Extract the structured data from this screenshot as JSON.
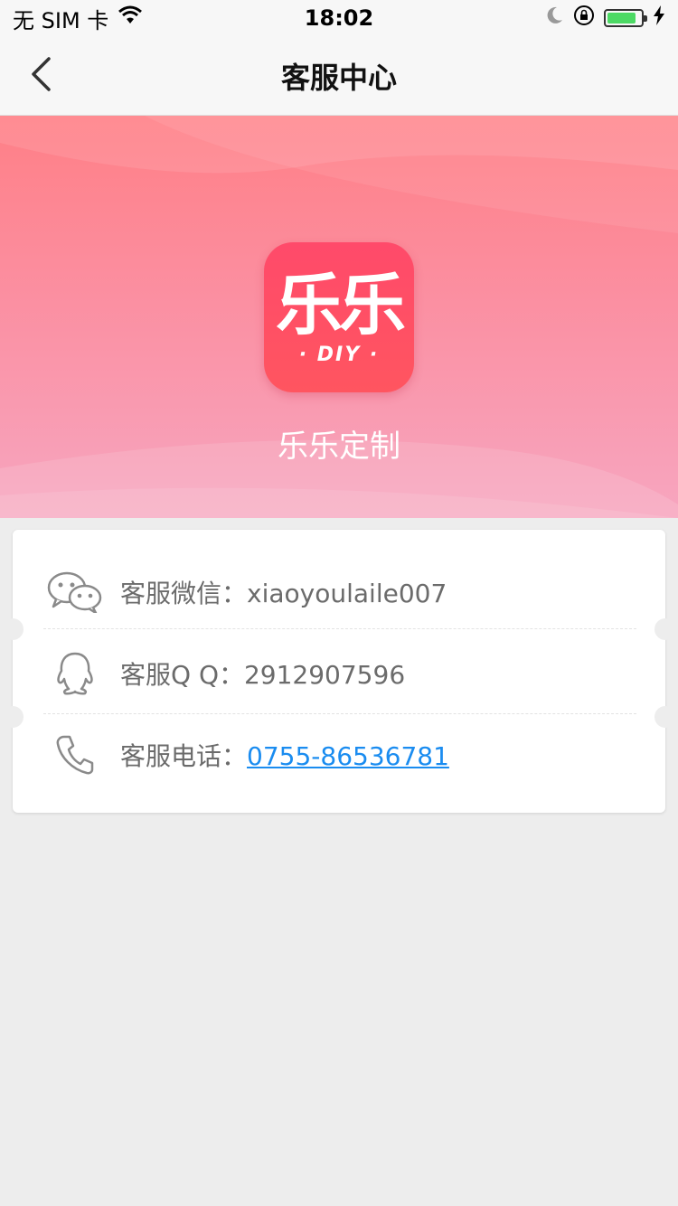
{
  "status_bar": {
    "carrier": "无 SIM 卡",
    "time": "18:02",
    "battery_level": 0.85,
    "battery_color": "#4cd964"
  },
  "nav": {
    "title": "客服中心",
    "back_icon": "chevron-left-icon"
  },
  "hero": {
    "logo_main": "乐乐",
    "logo_sub": "· DIY ·",
    "app_name": "乐乐定制",
    "gradient_top": "#ff7f86",
    "gradient_bottom": "#f7a6c0",
    "logo_color": "#ff4a6a"
  },
  "contacts": {
    "wechat": {
      "icon": "wechat-icon",
      "label": "客服微信：",
      "value": "xiaoyoulaile007"
    },
    "qq": {
      "icon": "qq-icon",
      "label": "客服Q Q：",
      "value": "2912907596"
    },
    "phone": {
      "icon": "phone-icon",
      "label": "客服电话：",
      "value": "0755-86536781",
      "link_color": "#1a8cf0"
    }
  }
}
